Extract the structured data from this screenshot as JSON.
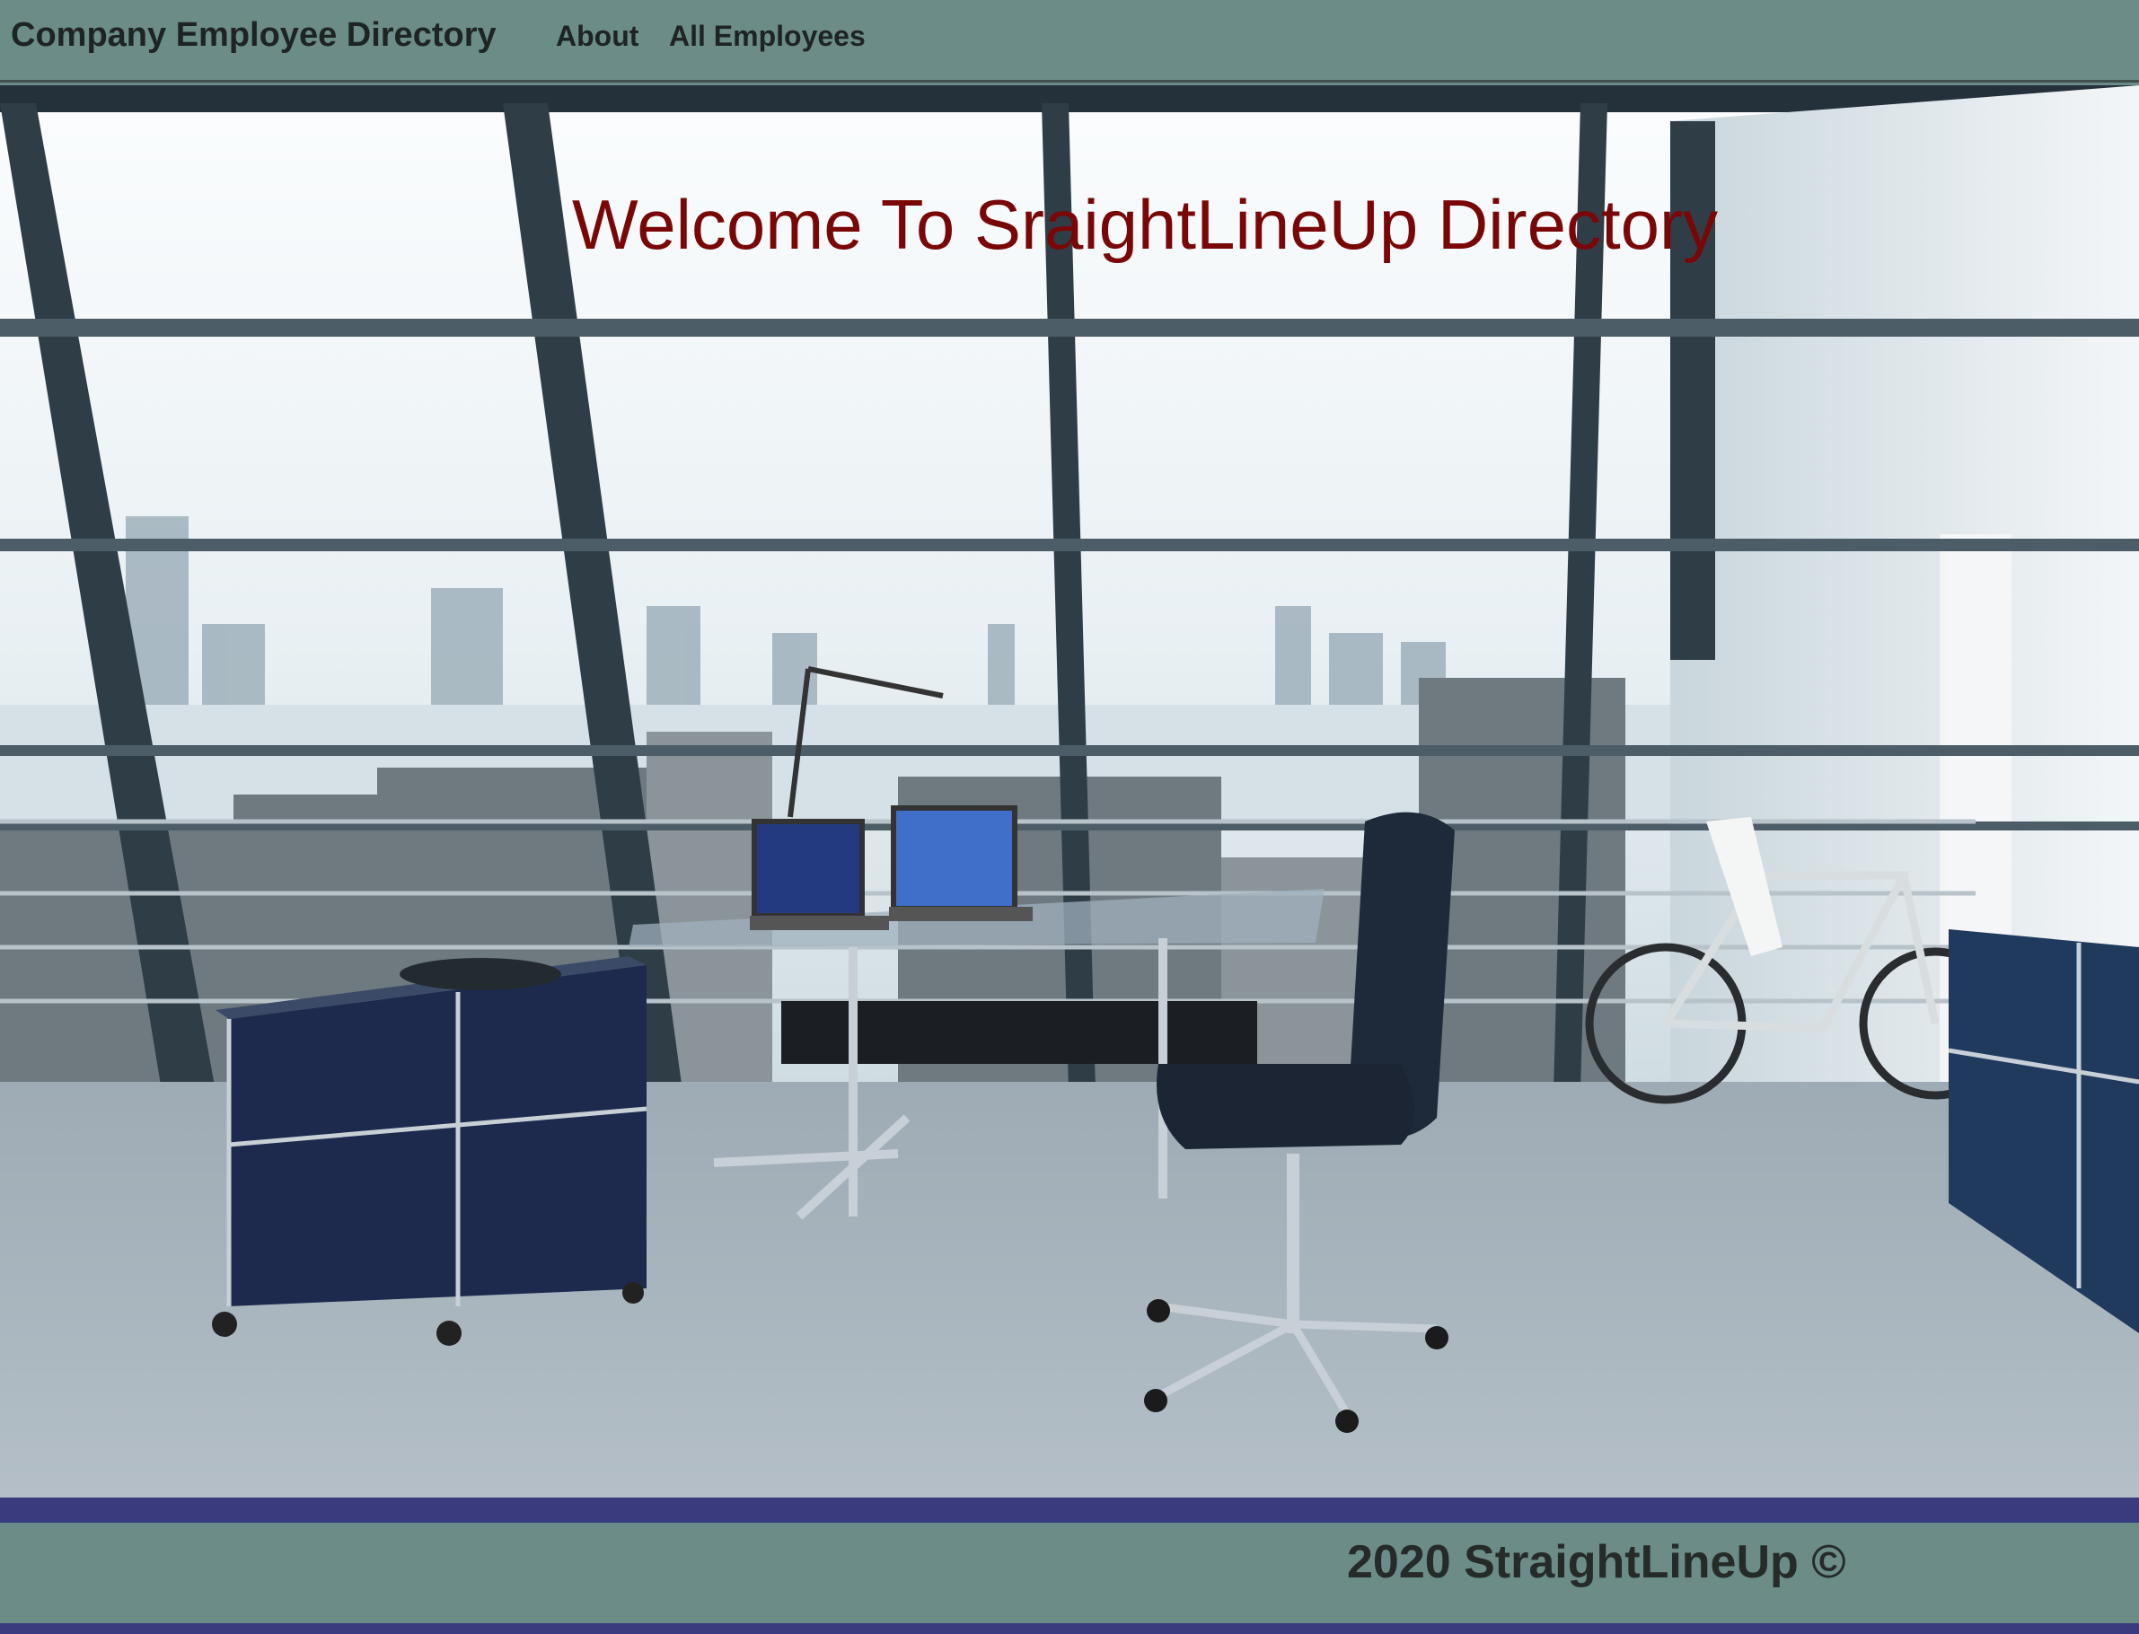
{
  "navbar": {
    "brand": "Company Employee Directory",
    "links": [
      {
        "label": "About"
      },
      {
        "label": "All Employees"
      }
    ]
  },
  "hero": {
    "title": "Welcome To SraightLineUp Directory"
  },
  "footer": {
    "text": "2020 StraightLineUp ©"
  },
  "colors": {
    "navbar_bg": "#6b8c87",
    "title_color": "#7a0707",
    "footer_band": "#3a3a7e"
  }
}
